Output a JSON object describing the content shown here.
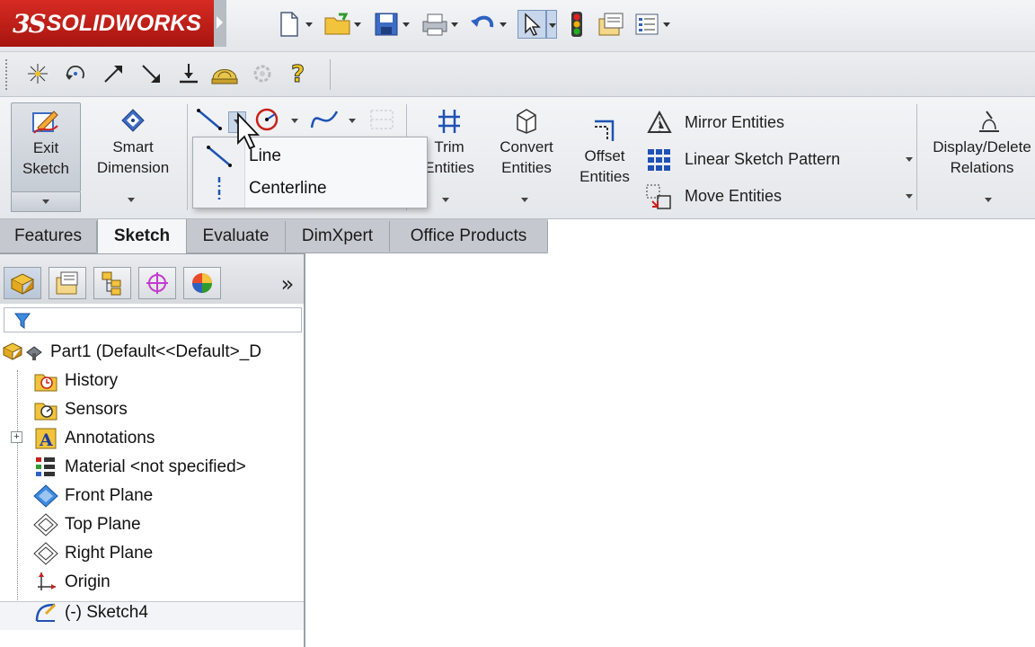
{
  "app": {
    "logo_ds": "3S",
    "logo_name": "SOLIDWORKS"
  },
  "colors": {
    "brand_red": "#c8201a",
    "selected_bg": "#c7d6ea"
  },
  "quick_access": {
    "icons": [
      "new-document-icon",
      "open-folder-icon",
      "save-icon",
      "print-icon",
      "undo-icon",
      "select-pointer-icon",
      "rebuild-traffic-light-icon",
      "file-properties-icon",
      "options-list-icon"
    ]
  },
  "toolbar2": {
    "icons": [
      "point-icon",
      "rotate-icon",
      "arrow-up-right-icon",
      "arrow-down-right-icon",
      "ground-icon",
      "helmet-icon",
      "gear-disabled-icon",
      "help-icon"
    ]
  },
  "ribbon": {
    "exit_sketch": "Exit Sketch",
    "smart_dimension": "Smart Dimension",
    "trim_entities": "Trim Entities",
    "convert_entities": "Convert Entities",
    "offset_entities": "Offset Entities",
    "mirror_entities": "Mirror Entities",
    "linear_sketch_pattern": "Linear Sketch Pattern",
    "move_entities": "Move Entities",
    "display_delete_relations": "Display/Delete Relations"
  },
  "line_menu": {
    "items": [
      "Line",
      "Centerline"
    ]
  },
  "tabs": [
    "Features",
    "Sketch",
    "Evaluate",
    "DimXpert",
    "Office Products"
  ],
  "active_tab": "Sketch",
  "feature_tree": {
    "part": "Part1  (Default<<Default>_D",
    "items": [
      "History",
      "Sensors",
      "Annotations",
      "Material <not specified>",
      "Front Plane",
      "Top Plane",
      "Right Plane",
      "Origin",
      "(-) Sketch4"
    ]
  }
}
